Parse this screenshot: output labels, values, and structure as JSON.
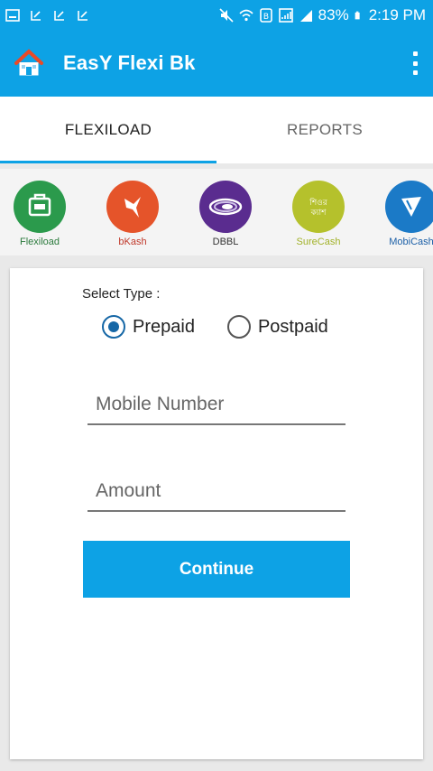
{
  "status_bar": {
    "battery": "83%",
    "time": "2:19 PM"
  },
  "app": {
    "title": "EasY Flexi Bk"
  },
  "tabs": [
    {
      "label": "FLEXILOAD"
    },
    {
      "label": "REPORTS"
    }
  ],
  "services": [
    {
      "label": "Flexiload",
      "color": "#2b9a4c",
      "label_color": "#2b7a3c",
      "icon": "flexiload-icon"
    },
    {
      "label": "bKash",
      "color": "#e5542a",
      "label_color": "#c0382a",
      "icon": "bkash-bird-icon"
    },
    {
      "label": "DBBL",
      "color": "#5a2c8f",
      "label_color": "#333333",
      "icon": "dbbl-logo-icon"
    },
    {
      "label": "SureCash",
      "color": "#b5c12c",
      "label_color": "#a2b22a",
      "icon": "surecash-logo-icon",
      "logo_text": "শিওর ক্যাশ"
    },
    {
      "label": "MobiCash",
      "color": "#1b7ac7",
      "label_color": "#1b5fa7",
      "icon": "mobicash-logo-icon"
    }
  ],
  "form": {
    "select_type_label": "Select Type :",
    "prepaid_label": "Prepaid",
    "postpaid_label": "Postpaid",
    "selected": "Prepaid",
    "mobile_placeholder": "Mobile Number",
    "amount_placeholder": "Amount",
    "continue_label": "Continue"
  },
  "colors": {
    "primary": "#0da2e5",
    "radio_checked": "#1667a6"
  }
}
